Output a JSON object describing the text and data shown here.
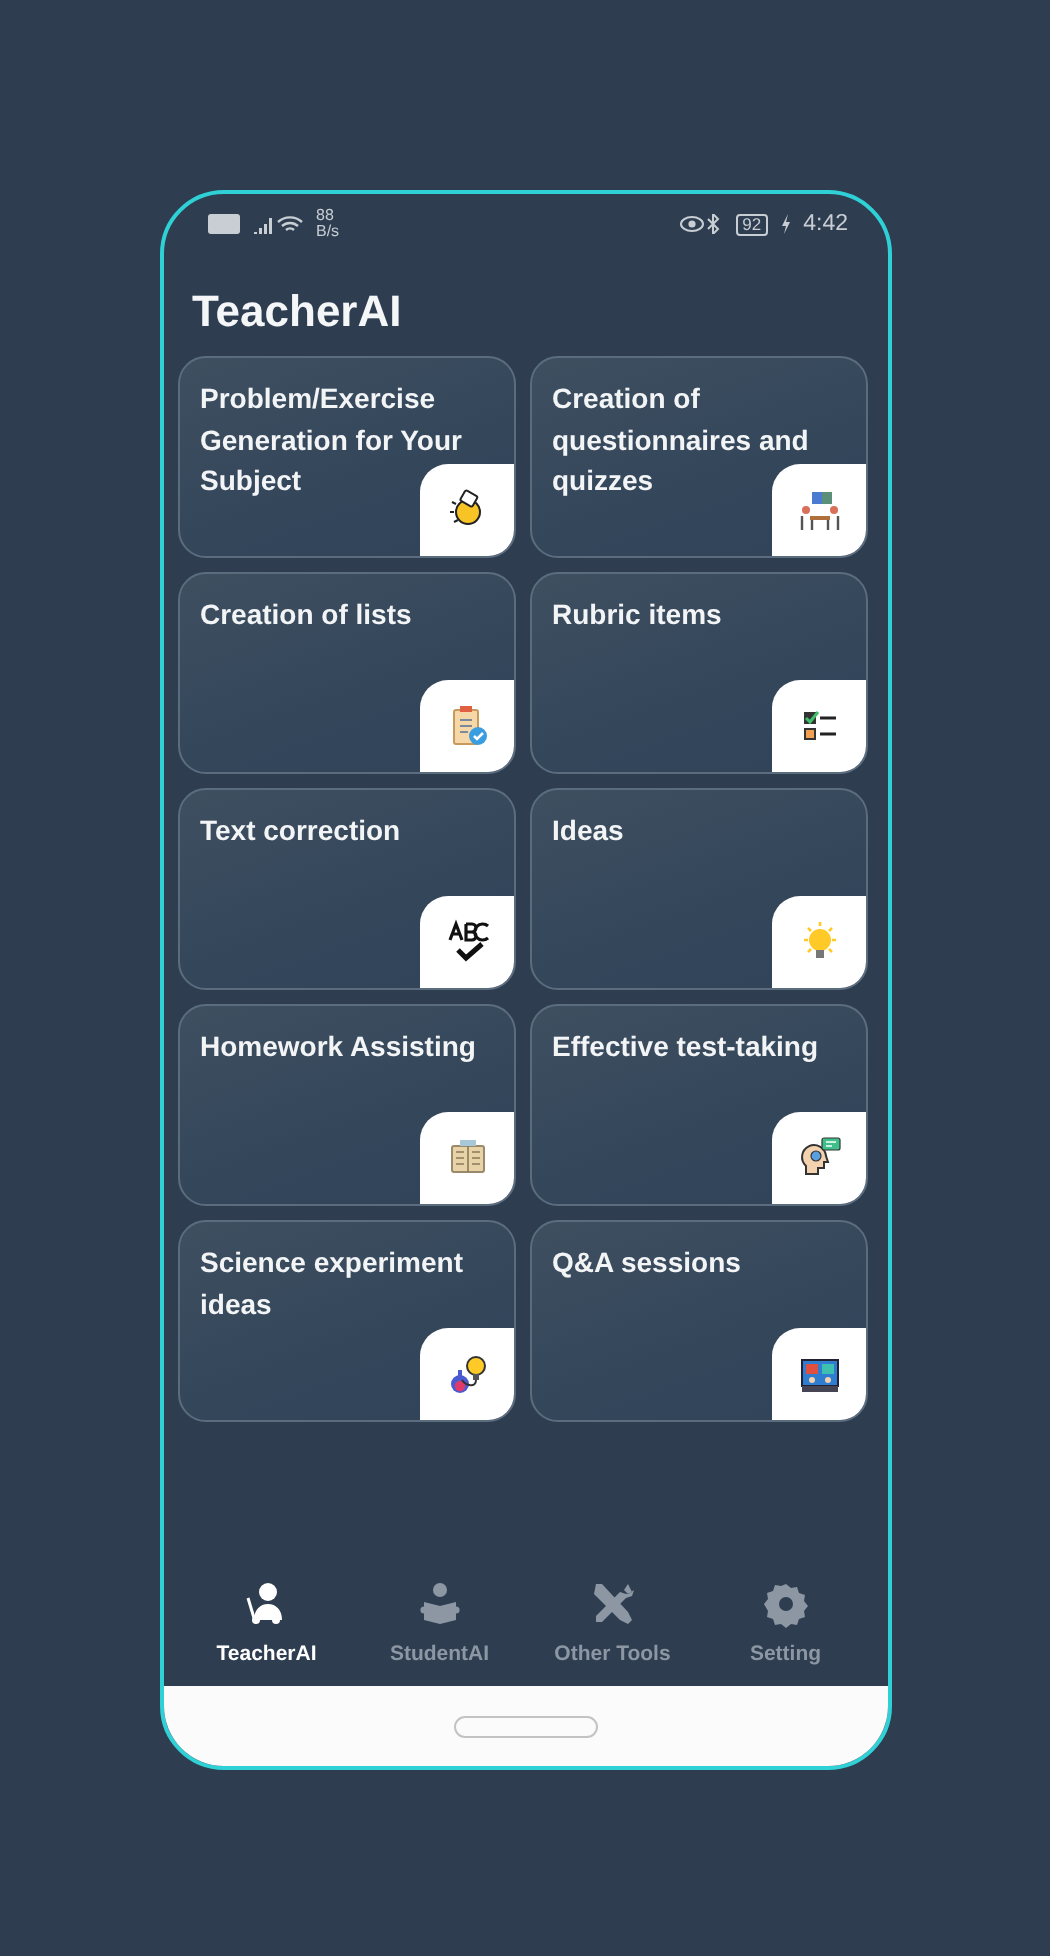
{
  "status_bar": {
    "net_speed": "88",
    "net_unit": "B/s",
    "battery": "92",
    "time": "4:42"
  },
  "title": "TeacherAI",
  "cards": [
    {
      "title": "Problem/Exercise Generation for Your Subject"
    },
    {
      "title": "Creation of questionnaires and quizzes"
    },
    {
      "title": "Creation of lists"
    },
    {
      "title": "Rubric items"
    },
    {
      "title": "Text correction"
    },
    {
      "title": "Ideas"
    },
    {
      "title": "Homework Assisting"
    },
    {
      "title": "Effective test-taking"
    },
    {
      "title": "Science experiment ideas"
    },
    {
      "title": "Q&A sessions"
    }
  ],
  "nav": [
    {
      "label": "TeacherAI",
      "selected": true
    },
    {
      "label": "StudentAI",
      "selected": false
    },
    {
      "label": "Other Tools",
      "selected": false
    },
    {
      "label": "Setting",
      "selected": false
    }
  ]
}
